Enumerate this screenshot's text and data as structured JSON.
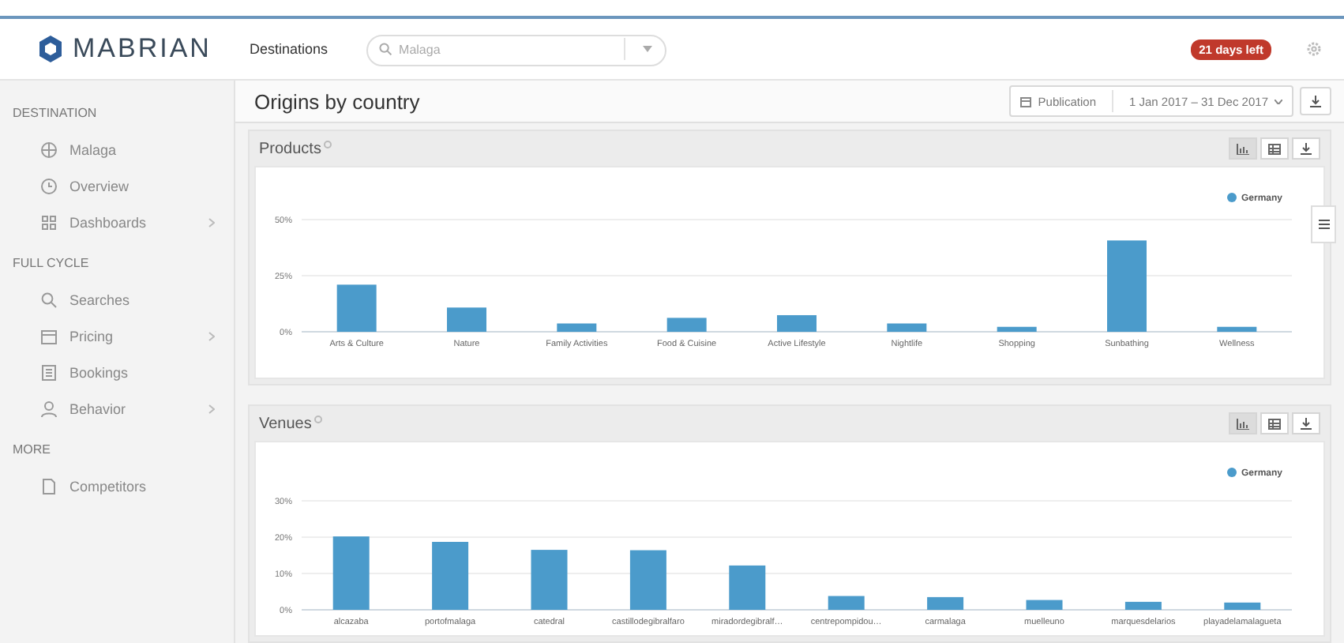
{
  "header": {
    "logo": "MABRIAN",
    "section": "Destinations",
    "search": {
      "placeholder": "Malaga"
    },
    "trial_badge": "21 days left"
  },
  "sidebar": {
    "groups": [
      {
        "title": "DESTINATION",
        "items": [
          {
            "label": "Malaga",
            "has_submenu": false
          },
          {
            "label": "Overview",
            "has_submenu": false
          },
          {
            "label": "Dashboards",
            "has_submenu": true
          }
        ]
      },
      {
        "title": "FULL CYCLE",
        "items": [
          {
            "label": "Searches",
            "has_submenu": false
          },
          {
            "label": "Pricing",
            "has_submenu": true
          },
          {
            "label": "Bookings",
            "has_submenu": false
          },
          {
            "label": "Behavior",
            "has_submenu": true
          }
        ]
      },
      {
        "title": "MORE",
        "items": [
          {
            "label": "Competitors",
            "has_submenu": false
          }
        ]
      }
    ]
  },
  "page": {
    "title": "Origins by country",
    "date_type": "Publication",
    "date_range": "1 Jan 2017 – 31 Dec 2017"
  },
  "panels": [
    {
      "title": "Products",
      "view_modes": [
        {
          "kind": "chart",
          "selected": true
        },
        {
          "kind": "table",
          "selected": false
        }
      ],
      "chart_data": {
        "type": "bar",
        "categories": [
          "Arts & Culture",
          "Nature",
          "Family Activities",
          "Food & Cuisine",
          "Active Lifestyle",
          "Nightlife",
          "Shopping",
          "Sunbathing",
          "Wellness"
        ],
        "series": [
          {
            "name": "Germany",
            "color": "#4b9bcb",
            "values": [
              21,
              10.8,
              3.7,
              6.2,
              7.4,
              3.7,
              2.2,
              40.7,
              2.2
            ]
          }
        ],
        "ylim": [
          0,
          50
        ],
        "yticks": [
          {
            "value": 0,
            "label": "0%"
          },
          {
            "value": 25,
            "label": "25%"
          },
          {
            "value": 50,
            "label": "50%"
          }
        ]
      }
    },
    {
      "title": "Venues",
      "view_modes": [
        {
          "kind": "chart",
          "selected": true
        },
        {
          "kind": "table",
          "selected": false
        }
      ],
      "chart_data": {
        "type": "bar",
        "categories": [
          "alcazaba",
          "portofmalaga",
          "catedral",
          "castillodegibralfaro",
          "miradordegibralf…",
          "centrepompidou…",
          "carmalaga",
          "muelleuno",
          "marquesdelarios",
          "playadelamalagueta"
        ],
        "series": [
          {
            "name": "Germany",
            "color": "#4b9bcb",
            "values": [
              20.2,
              18.7,
              16.5,
              16.4,
              12.2,
              3.8,
              3.5,
              2.7,
              2.2,
              2.0
            ]
          }
        ],
        "ylim": [
          0,
          30
        ],
        "yticks": [
          {
            "value": 0,
            "label": "0%"
          },
          {
            "value": 10,
            "label": "10%"
          },
          {
            "value": 20,
            "label": "20%"
          },
          {
            "value": 30,
            "label": "30%"
          }
        ]
      }
    }
  ]
}
